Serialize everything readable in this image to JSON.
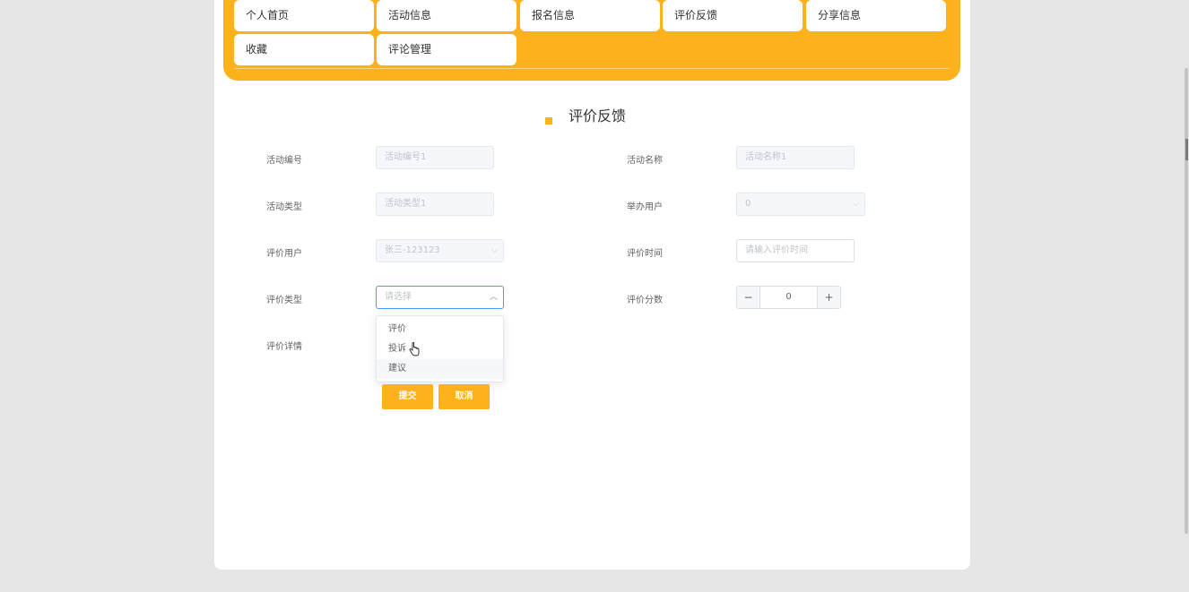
{
  "nav": {
    "items": [
      {
        "label": "个人首页"
      },
      {
        "label": "活动信息"
      },
      {
        "label": "报名信息"
      },
      {
        "label": "评价反馈"
      },
      {
        "label": "分享信息"
      },
      {
        "label": "收藏"
      },
      {
        "label": "评论管理"
      }
    ]
  },
  "form": {
    "title": "评价反馈",
    "fields": {
      "activity_no": {
        "label": "活动编号",
        "value": "活动编号1"
      },
      "activity_name": {
        "label": "活动名称",
        "value": "活动名称1"
      },
      "activity_type": {
        "label": "活动类型",
        "value": "活动类型1"
      },
      "host_user": {
        "label": "举办用户",
        "value": "0"
      },
      "review_user": {
        "label": "评价用户",
        "value": "张三-123123"
      },
      "review_time": {
        "label": "评价时间",
        "placeholder": "请输入评价时间"
      },
      "review_type": {
        "label": "评价类型",
        "placeholder": "请选择",
        "options": [
          "评价",
          "投诉",
          "建议"
        ]
      },
      "review_score": {
        "label": "评价分数",
        "value": "0"
      },
      "review_detail": {
        "label": "评价详情"
      }
    },
    "buttons": {
      "submit": "提交",
      "cancel": "取消"
    }
  },
  "icons": {
    "minus": "−",
    "plus": "+",
    "chevron_down": "⌵",
    "chevron_up": "︿"
  },
  "colors": {
    "accent": "#fdb11c",
    "focus": "#409eff"
  }
}
